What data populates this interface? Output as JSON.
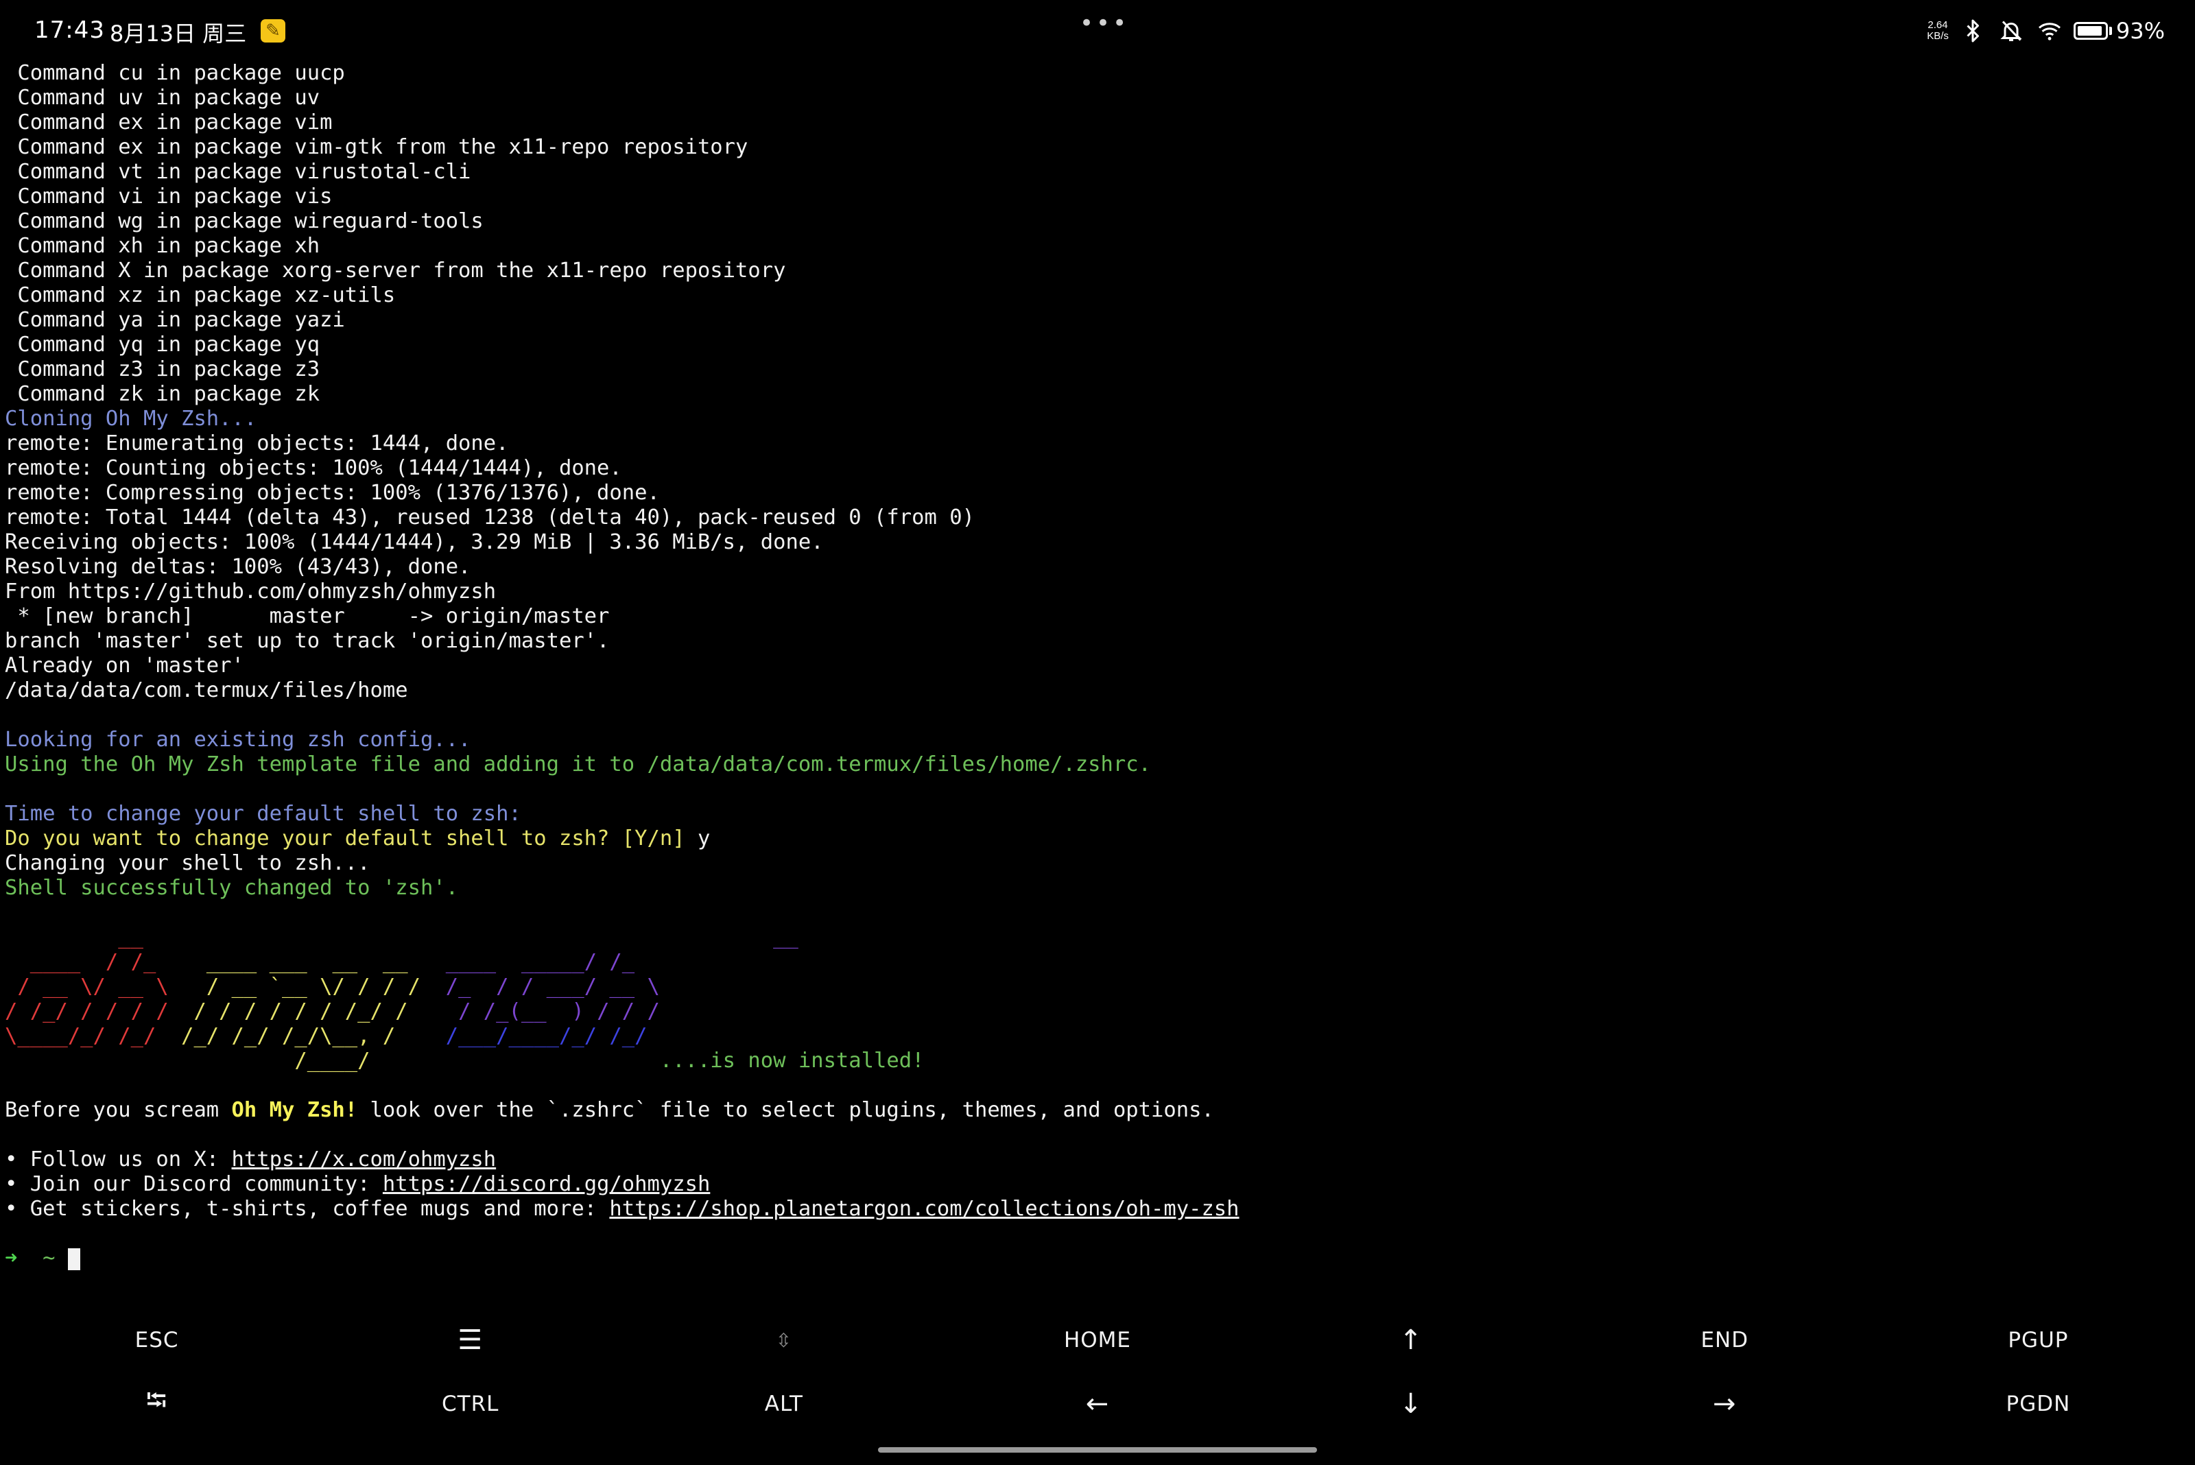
{
  "status_bar": {
    "time": "17:43",
    "date": "8月13日 周三",
    "net_speed_value": "2.64",
    "net_speed_unit": "KB/s",
    "battery": "93%",
    "battery_level": 0.93,
    "icons": [
      "note-icon",
      "more-dots-icon",
      "bluetooth-icon",
      "mute-bell-icon",
      "wifi-icon",
      "battery-icon"
    ]
  },
  "terminal": {
    "lines": [
      {
        "text": " Command cu in package uucp",
        "color": "white"
      },
      {
        "text": " Command uv in package uv",
        "color": "white"
      },
      {
        "text": " Command ex in package vim",
        "color": "white"
      },
      {
        "text": " Command ex in package vim-gtk from the x11-repo repository",
        "color": "white"
      },
      {
        "text": " Command vt in package virustotal-cli",
        "color": "white"
      },
      {
        "text": " Command vi in package vis",
        "color": "white"
      },
      {
        "text": " Command wg in package wireguard-tools",
        "color": "white"
      },
      {
        "text": " Command xh in package xh",
        "color": "white"
      },
      {
        "text": " Command X in package xorg-server from the x11-repo repository",
        "color": "white"
      },
      {
        "text": " Command xz in package xz-utils",
        "color": "white"
      },
      {
        "text": " Command ya in package yazi",
        "color": "white"
      },
      {
        "text": " Command yq in package yq",
        "color": "white"
      },
      {
        "text": " Command z3 in package z3",
        "color": "white"
      },
      {
        "text": " Command zk in package zk",
        "color": "white"
      },
      {
        "text": "Cloning Oh My Zsh...",
        "color": "blue"
      },
      {
        "text": "remote: Enumerating objects: 1444, done.",
        "color": "white"
      },
      {
        "text": "remote: Counting objects: 100% (1444/1444), done.",
        "color": "white"
      },
      {
        "text": "remote: Compressing objects: 100% (1376/1376), done.",
        "color": "white"
      },
      {
        "text": "remote: Total 1444 (delta 43), reused 1238 (delta 40), pack-reused 0 (from 0)",
        "color": "white"
      },
      {
        "text": "Receiving objects: 100% (1444/1444), 3.29 MiB | 3.36 MiB/s, done.",
        "color": "white"
      },
      {
        "text": "Resolving deltas: 100% (43/43), done.",
        "color": "white"
      },
      {
        "text": "From https://github.com/ohmyzsh/ohmyzsh",
        "color": "white"
      },
      {
        "text": " * [new branch]      master     -> origin/master",
        "color": "white"
      },
      {
        "text": "branch 'master' set up to track 'origin/master'.",
        "color": "white"
      },
      {
        "text": "Already on 'master'",
        "color": "white"
      },
      {
        "text": "/data/data/com.termux/files/home",
        "color": "white"
      },
      {
        "text": "",
        "color": "white"
      },
      {
        "text": "Looking for an existing zsh config...",
        "color": "blue"
      },
      {
        "text": "Using the Oh My Zsh template file and adding it to /data/data/com.termux/files/home/.zshrc.",
        "color": "green"
      },
      {
        "text": "",
        "color": "white"
      },
      {
        "text": "Time to change your default shell to zsh:",
        "color": "blue"
      },
      {
        "text": "Do you want to change your default shell to zsh? [Y/n]",
        "color": "yellow",
        "suffix": " y"
      },
      {
        "text": "Changing your shell to zsh...",
        "color": "white"
      },
      {
        "text": "Shell successfully changed to 'zsh'.",
        "color": "green"
      }
    ],
    "ascii_art": [
      [
        {
          "t": "         __     ",
          "c": "c-red"
        },
        {
          "t": "                                 ",
          "c": "c-yellow"
        },
        {
          "t": "            __  ",
          "c": "c-purple"
        }
      ],
      [
        {
          "t": "  ____  / /_    ",
          "c": "c-red"
        },
        {
          "t": "____ ___  __  __  ",
          "c": "c-yellow"
        },
        {
          "t": " ____  _____/ /_ ",
          "c": "c-purple"
        }
      ],
      [
        {
          "t": " / __ \\/ __ \\  ",
          "c": "c-red"
        },
        {
          "t": " / __ `__ \\/ / / / ",
          "c": "c-yellow"
        },
        {
          "t": " /_  / / ___/ __ \\",
          "c": "c-purple"
        }
      ],
      [
        {
          "t": "/ /_/ / / / /  ",
          "c": "c-red"
        },
        {
          "t": "/ / / / / / /_/ /   ",
          "c": "c-yellow"
        },
        {
          "t": " / /_(__  ) / / /",
          "c": "c-purple"
        }
      ],
      [
        {
          "t": "\\____/_/ /_/  ",
          "c": "c-red"
        },
        {
          "t": "/_/ /_/ /_/\\__, /   ",
          "c": "c-yellow"
        },
        {
          "t": " /___/____/_/ /_/",
          "c": "c-blue"
        }
      ],
      [
        {
          "t": "                       /____/   ",
          "c": "c-yellow"
        },
        {
          "t": "                    ....is now installed!",
          "c": "green"
        }
      ]
    ],
    "before_scream": {
      "prefix": "Before you scream ",
      "highlight": "Oh My Zsh!",
      "suffix": " look over the ",
      "file": "`.zshrc`",
      "end": " file to select plugins, themes, and options."
    },
    "bullets": [
      {
        "label": "• Follow us on X: ",
        "link": "https://x.com/ohmyzsh"
      },
      {
        "label": "• Join our Discord community: ",
        "link": "https://discord.gg/ohmyzsh"
      },
      {
        "label": "• Get stickers, t-shirts, coffee mugs and more: ",
        "link": "https://shop.planetargon.com/collections/oh-my-zsh"
      }
    ],
    "prompt": {
      "arrow": "➜",
      "dir": "~"
    }
  },
  "extra_keys": {
    "row1": [
      {
        "label": "ESC",
        "name": "esc-key"
      },
      {
        "label": "☰",
        "name": "drawer-key"
      },
      {
        "label": "⇳",
        "name": "scroll-key"
      },
      {
        "label": "HOME",
        "name": "home-key"
      },
      {
        "label": "↑",
        "name": "up-arrow-key"
      },
      {
        "label": "END",
        "name": "end-key"
      },
      {
        "label": "PGUP",
        "name": "pgup-key"
      }
    ],
    "row2": [
      {
        "label": "⭾",
        "name": "tab-key"
      },
      {
        "label": "CTRL",
        "name": "ctrl-key"
      },
      {
        "label": "ALT",
        "name": "alt-key"
      },
      {
        "label": "←",
        "name": "left-arrow-key"
      },
      {
        "label": "↓",
        "name": "down-arrow-key"
      },
      {
        "label": "→",
        "name": "right-arrow-key"
      },
      {
        "label": "PGDN",
        "name": "pgdn-key"
      }
    ]
  }
}
